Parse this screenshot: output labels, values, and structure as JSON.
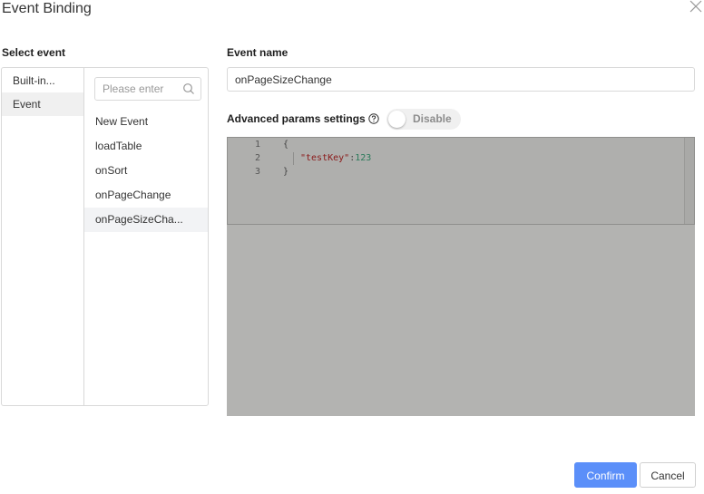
{
  "dialog": {
    "title": "Event Binding"
  },
  "left": {
    "section_label": "Select event",
    "categories": [
      {
        "label": "Built-in..."
      },
      {
        "label": "Event"
      }
    ],
    "search_placeholder": "Please enter",
    "events": [
      {
        "label": "New Event"
      },
      {
        "label": "loadTable"
      },
      {
        "label": "onSort"
      },
      {
        "label": "onPageChange"
      },
      {
        "label": "onPageSizeCha..."
      }
    ]
  },
  "right": {
    "event_name_label": "Event name",
    "event_name_value": "onPageSizeChange",
    "advanced_label": "Advanced params settings",
    "toggle_label": "Disable",
    "editor": {
      "lines": [
        {
          "no": "1",
          "code": "{"
        },
        {
          "no": "2",
          "key": "\"testKey\"",
          "sep": ":",
          "value": "123"
        },
        {
          "no": "3",
          "code": "}"
        }
      ]
    }
  },
  "footer": {
    "confirm_label": "Confirm",
    "cancel_label": "Cancel"
  }
}
